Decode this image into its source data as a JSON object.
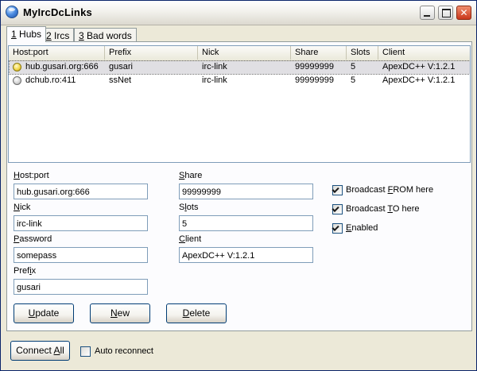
{
  "window": {
    "title": "MyIrcDcLinks"
  },
  "tabs": [
    {
      "key": "1",
      "rest": " Hubs"
    },
    {
      "key": "2",
      "rest": " Ircs"
    },
    {
      "key": "3",
      "rest": " Bad words"
    }
  ],
  "list": {
    "columns": [
      "Host:port",
      "Prefix",
      "Nick",
      "Share",
      "Slots",
      "Client"
    ],
    "rows": [
      {
        "host": "hub.gusari.org:666",
        "prefix": "gusari",
        "nick": "irc-link",
        "share": "99999999",
        "slots": "5",
        "client": "ApexDC++ V:1.2.1",
        "status_icon": "online-hub-icon"
      },
      {
        "host": "dchub.ro:411",
        "prefix": "ssNet",
        "nick": "irc-link",
        "share": "99999999",
        "slots": "5",
        "client": "ApexDC++ V:1.2.1",
        "status_icon": "offline-hub-icon"
      }
    ]
  },
  "form": {
    "host_label_key": "H",
    "host_label_rest": "ost:port",
    "host_value": "hub.gusari.org:666",
    "nick_label_key": "N",
    "nick_label_rest": "ick",
    "nick_value": "irc-link",
    "password_label_key": "P",
    "password_label_rest": "assword",
    "password_value": "somepass",
    "prefix_label_pre": "Pref",
    "prefix_label_key": "i",
    "prefix_label_rest": "x",
    "prefix_value": "gusari",
    "share_label_key": "S",
    "share_label_rest": "hare",
    "share_value": "99999999",
    "slots_label_pre": "S",
    "slots_label_key": "l",
    "slots_label_rest": "ots",
    "slots_value": "5",
    "client_label_key": "C",
    "client_label_rest": "lient",
    "client_value": "ApexDC++ V:1.2.1"
  },
  "options": {
    "broadcast_from_pre": "Broadcast ",
    "broadcast_from_key": "F",
    "broadcast_from_rest": "ROM here",
    "broadcast_from_checked": true,
    "broadcast_to_pre": "Broadcast ",
    "broadcast_to_key": "T",
    "broadcast_to_rest": "O here",
    "broadcast_to_checked": true,
    "enabled_key": "E",
    "enabled_rest": "nabled",
    "enabled_checked": true
  },
  "buttons": {
    "update_key": "U",
    "update_rest": "pdate",
    "new_key": "N",
    "new_rest": "ew",
    "delete_key": "D",
    "delete_rest": "elete",
    "connect_pre": "Connect ",
    "connect_key": "A",
    "connect_rest": "ll"
  },
  "auto_reconnect": {
    "label": "Auto reconnect",
    "checked": false
  },
  "colors": {
    "title_bar": "#f2f1ec",
    "close_button": "#c9361b",
    "selected_row": "#e0dfe3",
    "window_bg": "#ece9d8"
  }
}
